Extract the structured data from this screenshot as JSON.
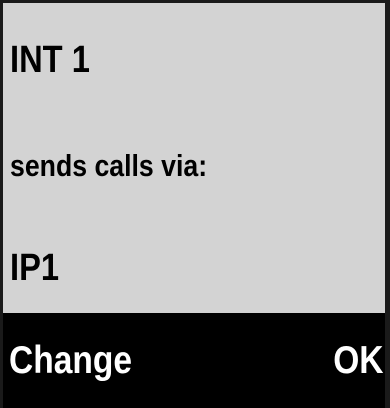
{
  "screen": {
    "title": "INT 1",
    "message": "sends calls via:",
    "value": "IP1"
  },
  "softkeys": {
    "left_label": "Change",
    "right_label": "OK"
  },
  "colors": {
    "background": "#d3d3d3",
    "softkey_bar": "#000000",
    "softkey_text": "#ffffff",
    "text": "#000000"
  }
}
